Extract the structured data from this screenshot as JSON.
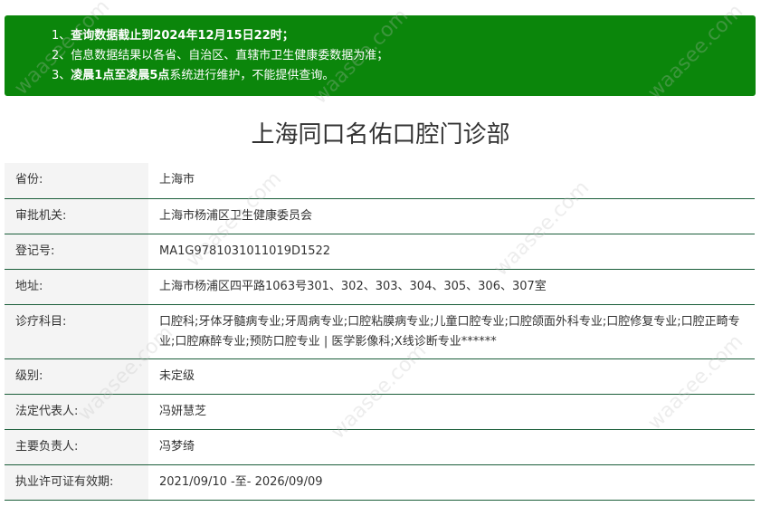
{
  "notice": {
    "lines": [
      {
        "num": "1、",
        "text": "查询数据截止到2024年12月15日22时；"
      },
      {
        "num": "2、",
        "text": "信息数据结果以各省、自治区、直辖市卫生健康委数据为准；"
      },
      {
        "num": "3、",
        "text_bold": "凌晨1点至凌晨5点",
        "text_rest": "系统进行维护，不能提供查询。"
      }
    ]
  },
  "title": "上海同口名佑口腔门诊部",
  "rows": [
    {
      "label": "省份:",
      "value": "上海市"
    },
    {
      "label": "审批机关:",
      "value": "上海市杨浦区卫生健康委员会"
    },
    {
      "label": "登记号:",
      "value": "MA1G9781031011019D1522"
    },
    {
      "label": "地址:",
      "value": "上海市杨浦区四平路1063号301、302、303、304、305、306、307室"
    },
    {
      "label": "诊疗科目:",
      "value": "口腔科;牙体牙髓病专业;牙周病专业;口腔粘膜病专业;儿童口腔专业;口腔颌面外科专业;口腔修复专业;口腔正畸专业;口腔麻醉专业;预防口腔专业 | 医学影像科;X线诊断专业******"
    },
    {
      "label": "级别:",
      "value": "未定级"
    },
    {
      "label": "法定代表人:",
      "value": "冯妍慧芝"
    },
    {
      "label": "主要负责人:",
      "value": "冯梦绮"
    },
    {
      "label": "执业许可证有效期:",
      "value": "2021/09/10 -至- 2026/09/09"
    }
  ],
  "watermark": "waasee.com",
  "colors": {
    "notice_bg": "#0b860b",
    "row_border": "#1b5e3a",
    "label_bg": "#f4f4f4"
  }
}
